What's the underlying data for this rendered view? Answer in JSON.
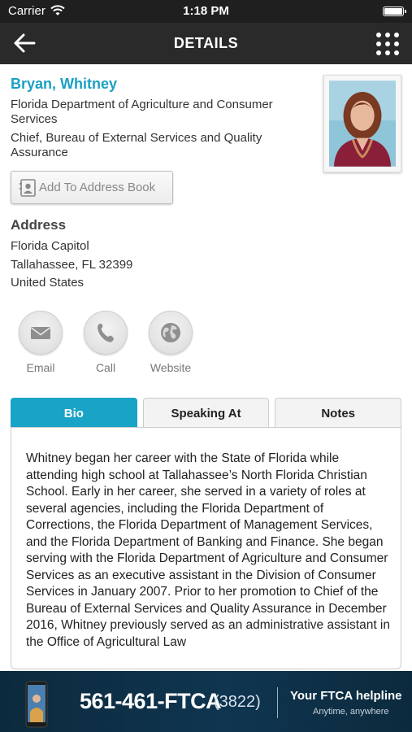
{
  "status_bar": {
    "carrier": "Carrier",
    "time": "1:18 PM"
  },
  "nav": {
    "title": "DETAILS",
    "back_icon": "back-arrow-icon",
    "menu_icon": "grid-menu-icon"
  },
  "profile": {
    "name": "Bryan, Whitney",
    "organization": "Florida Department of Agriculture and Consumer Services",
    "job_title": "Chief, Bureau of External  Services and Quality Assurance"
  },
  "add_to_address_book": {
    "label": "Add To Address Book",
    "icon": "contact-card-icon"
  },
  "address": {
    "heading": "Address",
    "lines": [
      "Florida Capitol",
      "Tallahassee, FL 32399",
      "United States"
    ]
  },
  "actions": [
    {
      "label": "Email",
      "icon": "envelope-icon"
    },
    {
      "label": "Call",
      "icon": "phone-icon"
    },
    {
      "label": "Website",
      "icon": "globe-icon"
    }
  ],
  "tabs": [
    {
      "label": "Bio",
      "active": true
    },
    {
      "label": "Speaking At",
      "active": false
    },
    {
      "label": "Notes",
      "active": false
    }
  ],
  "bio": {
    "text": "Whitney began her career with the State of Florida while attending high school at Tallahassee’s North Florida Christian School.  Early in her career, she served in a variety of roles at several agencies, including the Florida Department of Corrections, the Florida Department of Management Services, and the Florida Department of Banking and Finance. She began serving with the Florida Department of Agriculture and Consumer Services as an executive assistant in the Division of Consumer Services in January 2007. Prior to her promotion to Chief of the Bureau of External Services and Quality Assurance in December 2016, Whitney previously served as an administrative assistant in the Office of Agricultural Law"
  },
  "banner": {
    "number": "561-461-FTCA",
    "digits": "(3822)",
    "headline": "Your FTCA helpline",
    "tagline": "Anytime, anywhere"
  },
  "colors": {
    "accent": "#19a3c7",
    "nav_background": "#2a2a2a",
    "banner_background": "#0f3550"
  }
}
